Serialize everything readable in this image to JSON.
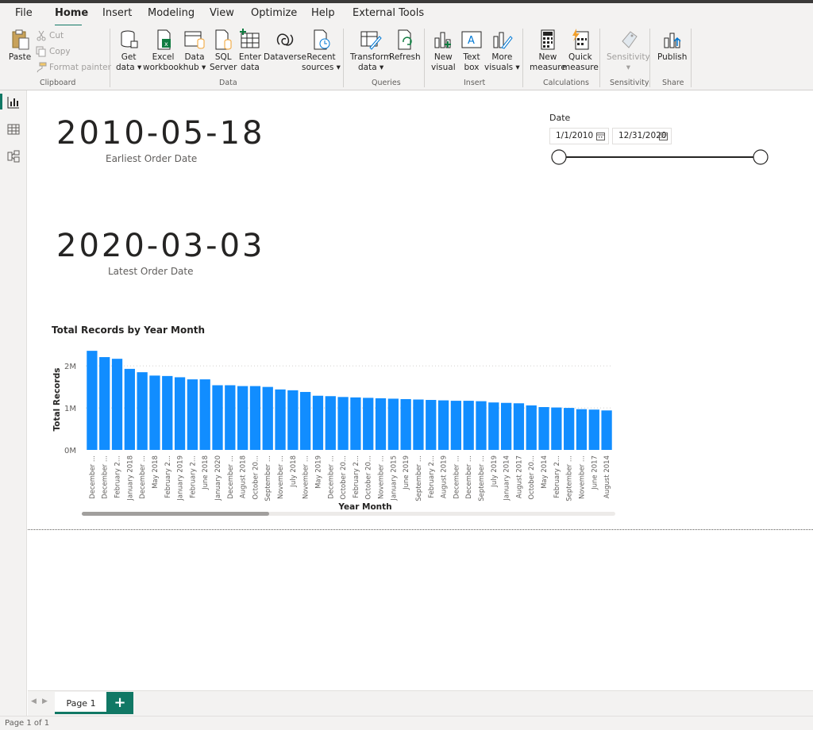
{
  "menu": {
    "tabs": [
      "File",
      "Home",
      "Insert",
      "Modeling",
      "View",
      "Optimize",
      "Help",
      "External Tools"
    ]
  },
  "ribbon": {
    "clipboard": {
      "paste": "Paste",
      "cut": "Cut",
      "copy": "Copy",
      "format_painter": "Format painter",
      "group": "Clipboard"
    },
    "data": {
      "get_data_1": "Get",
      "get_data_2": "data",
      "excel_1": "Excel",
      "excel_2": "workbook",
      "hub_1": "Data",
      "hub_2": "hub",
      "sql_1": "SQL",
      "sql_2": "Server",
      "enter_1": "Enter",
      "enter_2": "data",
      "dataverse": "Dataverse",
      "recent_1": "Recent",
      "recent_2": "sources",
      "group": "Data"
    },
    "queries": {
      "transform_1": "Transform",
      "transform_2": "data",
      "refresh": "Refresh",
      "group": "Queries"
    },
    "insert": {
      "newvis_1": "New",
      "newvis_2": "visual",
      "textbox_1": "Text",
      "textbox_2": "box",
      "more_1": "More",
      "more_2": "visuals",
      "group": "Insert"
    },
    "calculations": {
      "newmeasure_1": "New",
      "newmeasure_2": "measure",
      "quick_1": "Quick",
      "quick_2": "measure",
      "group": "Calculations"
    },
    "sensitivity": {
      "label": "Sensitivity",
      "group": "Sensitivity"
    },
    "share": {
      "publish": "Publish",
      "group": "Share"
    }
  },
  "cards": {
    "earliest": {
      "value": "2010-05-18",
      "label": "Earliest Order Date"
    },
    "latest": {
      "value": "2020-03-03",
      "label": "Latest Order Date"
    }
  },
  "slicer": {
    "title": "Date",
    "start": "1/1/2010",
    "end": "12/31/2020"
  },
  "chart_title": "Total Records by Year Month",
  "chart_data": {
    "type": "bar",
    "title": "Total Records by Year Month",
    "xlabel": "Year Month",
    "ylabel": "Total Records",
    "ylim": [
      0,
      2400000
    ],
    "yticks": [
      "0M",
      "1M",
      "2M"
    ],
    "grid": true,
    "categories": [
      "December ...",
      "December ...",
      "February 2...",
      "January 2018",
      "December ...",
      "May 2018",
      "February 2...",
      "January 2019",
      "February 2...",
      "June 2018",
      "January 2020",
      "December ...",
      "August 2018",
      "October 20...",
      "September ...",
      "November ...",
      "July 2018",
      "November ...",
      "May 2019",
      "December ...",
      "October 20...",
      "February 2...",
      "October 20...",
      "November ...",
      "January 2015",
      "June 2019",
      "September ...",
      "February 2...",
      "August 2019",
      "December ...",
      "December ...",
      "September ...",
      "July 2019",
      "January 2014",
      "August 2017",
      "October 20...",
      "May 2014",
      "February 2...",
      "September ...",
      "November ...",
      "June 2017",
      "August 2014"
    ],
    "values": [
      2360000,
      2210000,
      2170000,
      1930000,
      1850000,
      1770000,
      1760000,
      1730000,
      1680000,
      1680000,
      1540000,
      1540000,
      1520000,
      1520000,
      1500000,
      1440000,
      1420000,
      1380000,
      1290000,
      1280000,
      1260000,
      1250000,
      1240000,
      1230000,
      1220000,
      1210000,
      1200000,
      1190000,
      1180000,
      1170000,
      1170000,
      1160000,
      1130000,
      1120000,
      1110000,
      1060000,
      1020000,
      1010000,
      1000000,
      970000,
      960000,
      940000
    ]
  },
  "pages": {
    "tab": "Page 1",
    "add": "+"
  },
  "status": "Page 1 of 1",
  "colors": {
    "accent": "#117865",
    "bar": "#118DFF"
  }
}
